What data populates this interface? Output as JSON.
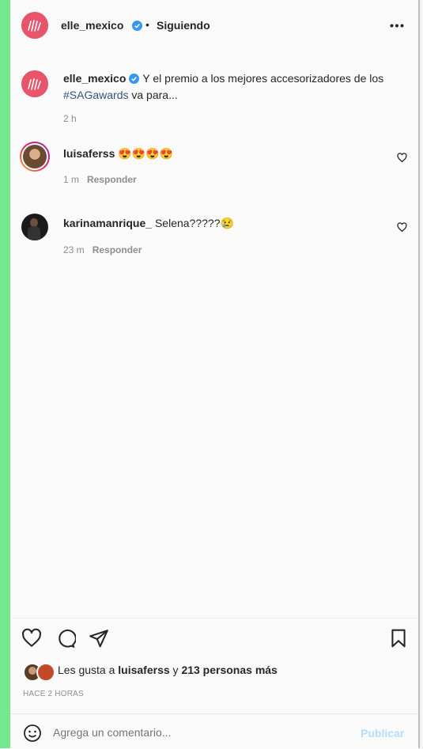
{
  "post": {
    "author": "elle_mexico",
    "separator": "•",
    "follow_status": "Siguiendo",
    "more_icon": "more-horizontal-icon"
  },
  "caption": {
    "username": "elle_mexico",
    "text_before": "Y el premio a los mejores accesorizadores de los ",
    "hashtag": "#SAGawards",
    "text_after": " va para...",
    "time": "2 h"
  },
  "comments": [
    {
      "username": "luisaferss",
      "text": "😍😍😍😍",
      "time": "1 m",
      "reply_label": "Responder"
    },
    {
      "username": "karinamanrique_",
      "text": "Selena?????😢",
      "time": "23 m",
      "reply_label": "Responder"
    }
  ],
  "likes": {
    "prefix": "Les gusta a ",
    "user": "luisaferss",
    "middle": " y ",
    "count": "213 personas más",
    "timestamp": "HACE 2 HORAS"
  },
  "comment_box": {
    "placeholder": "Agrega un comentario...",
    "publish_label": "Publicar"
  },
  "colors": {
    "brand": "#e8556a",
    "verified": "#3897f0",
    "link": "#385185",
    "publish_disabled": "#b2dffc"
  }
}
